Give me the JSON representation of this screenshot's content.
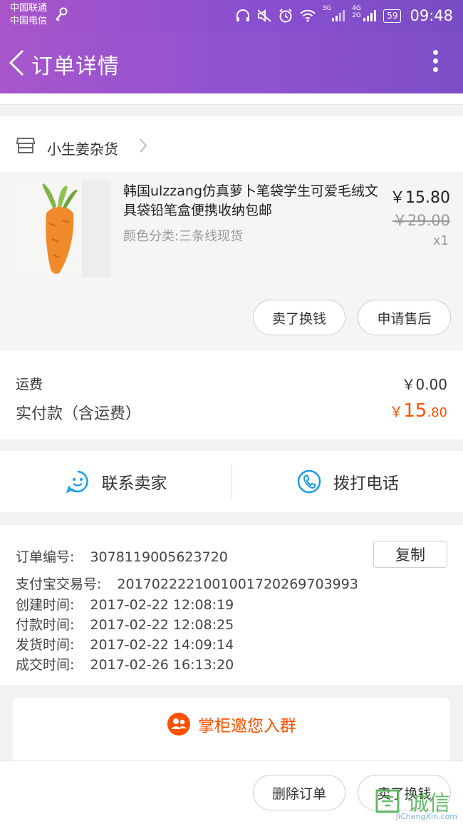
{
  "status_bar": {
    "carrier_1": "中国联通",
    "carrier_2": "中国电信",
    "signal_3g": "3G",
    "signal_4g": "4G",
    "signal_2g": "2G",
    "battery": "59",
    "time": "09:48"
  },
  "nav": {
    "title": "订单详情"
  },
  "shop": {
    "name": "小生姜杂货"
  },
  "product": {
    "title": "韩国ulzzang仿真萝卜笔袋学生可爱毛绒文具袋铅笔盒便携收纳包邮",
    "variant": "颜色分类:三条线现货",
    "price_now": "￥15.80",
    "price_old": "￥29.00",
    "qty": "x1",
    "btn_sell": "卖了换钱",
    "btn_aftersale": "申请售后"
  },
  "payment": {
    "shipping_label": "运费",
    "shipping_value": "￥0.00",
    "paid_label": "实付款（含运费）",
    "paid_yen": "￥",
    "paid_int": "15",
    "paid_dec": ".80"
  },
  "contact": {
    "seller": "联系卖家",
    "call": "拨打电话"
  },
  "order_info": {
    "order_no_label": "订单编号:",
    "order_no": "3078119005623720",
    "copy": "复制",
    "alipay_label": "支付宝交易号:",
    "alipay_no": "2017022221001001720269703993",
    "created_label": "创建时间:",
    "created": "2017-02-22 12:08:19",
    "paid_label": "付款时间:",
    "paid": "2017-02-22 12:08:25",
    "shipped_label": "发货时间:",
    "shipped": "2017-02-22 14:09:14",
    "done_label": "成交时间:",
    "done": "2017-02-26 16:13:20"
  },
  "group": {
    "text": "掌柜邀您入群"
  },
  "bottom": {
    "delete": "删除订单",
    "sell": "卖了换钱"
  },
  "watermark": {
    "main": "诚信",
    "sub": "JiChengXin.com"
  },
  "colors": {
    "accent": "#ff5000",
    "nav_start": "#a756cb",
    "nav_end": "#7d4dc8",
    "icon_blue": "#1a9be8"
  }
}
